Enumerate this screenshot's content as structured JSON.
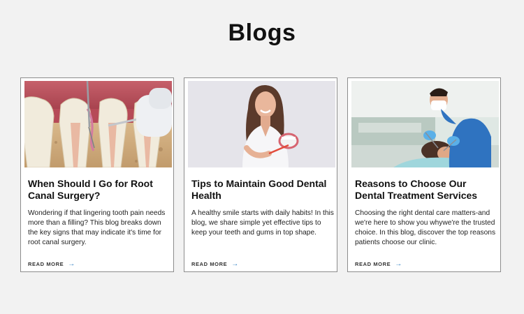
{
  "section": {
    "title": "Blogs"
  },
  "posts": [
    {
      "title": "When Should I Go for Root Canal Surgery?",
      "excerpt": "Wondering if that lingering tooth pain needs more than a filling? This blog breaks down the key signs that may indicate it's time for root canal surgery.",
      "read_more": "READ MORE",
      "arrow_icon": "arrow-right-icon",
      "image_icon": "tooth-cross-section-image"
    },
    {
      "title": "Tips to Maintain Good Dental Health",
      "excerpt": "A healthy smile starts with daily habits! In this blog, we share simple yet effective tips to keep your teeth and gums in top shape.",
      "read_more": "READ MORE",
      "arrow_icon": "arrow-right-icon",
      "image_icon": "woman-toothbrush-image"
    },
    {
      "title": "Reasons to Choose Our Dental Treatment Services",
      "excerpt": "Choosing the right dental care matters-and we're here to show you whywe're the trusted choice. In this blog, discover the top reasons patients choose our clinic.",
      "read_more": "READ MORE",
      "arrow_icon": "arrow-right-icon",
      "image_icon": "dentist-patient-image"
    }
  ],
  "colors": {
    "background": "#f2f2f2",
    "accent": "#2f7ec2",
    "card_border": "#8c8c8c"
  }
}
